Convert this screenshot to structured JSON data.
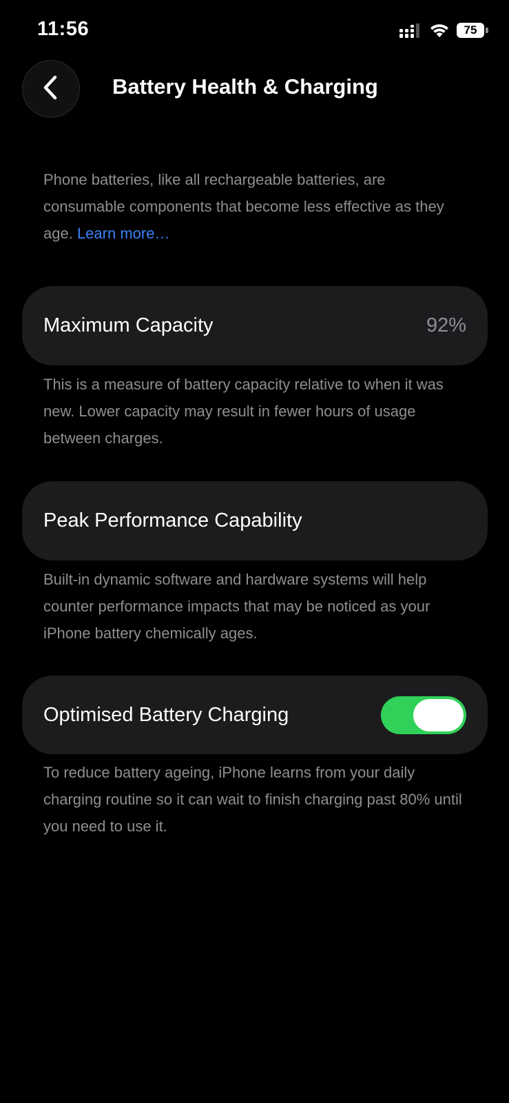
{
  "status_bar": {
    "time": "11:56",
    "battery_level": "75",
    "icons": [
      "signal-icon",
      "wifi-icon",
      "battery-icon"
    ]
  },
  "nav": {
    "back_icon": "chevron-left-icon",
    "title": "Battery Health & Charging"
  },
  "intro": {
    "text": "Phone batteries, like all rechargeable batteries, are consumable components that become less effective as they age. ",
    "learn_more": "Learn more…"
  },
  "maximum_capacity": {
    "label": "Maximum Capacity",
    "value": "92%",
    "footnote": "This is a measure of battery capacity relative to when it was new. Lower capacity may result in fewer hours of usage between charges."
  },
  "peak_performance": {
    "label": "Peak Performance Capability",
    "footnote": "Built-in dynamic software and hardware systems will help counter performance impacts that may be noticed as your iPhone battery chemically ages."
  },
  "optimised_charging": {
    "label": "Optimised Battery Charging",
    "enabled": true,
    "footnote": "To reduce battery ageing, iPhone learns from your daily charging routine so it can wait to finish charging past 80% until you need to use it."
  },
  "colors": {
    "background": "#000000",
    "card": "#1c1c1e",
    "secondary_text": "#8e8e93",
    "link": "#3b82f6",
    "toggle_on": "#30d158"
  }
}
